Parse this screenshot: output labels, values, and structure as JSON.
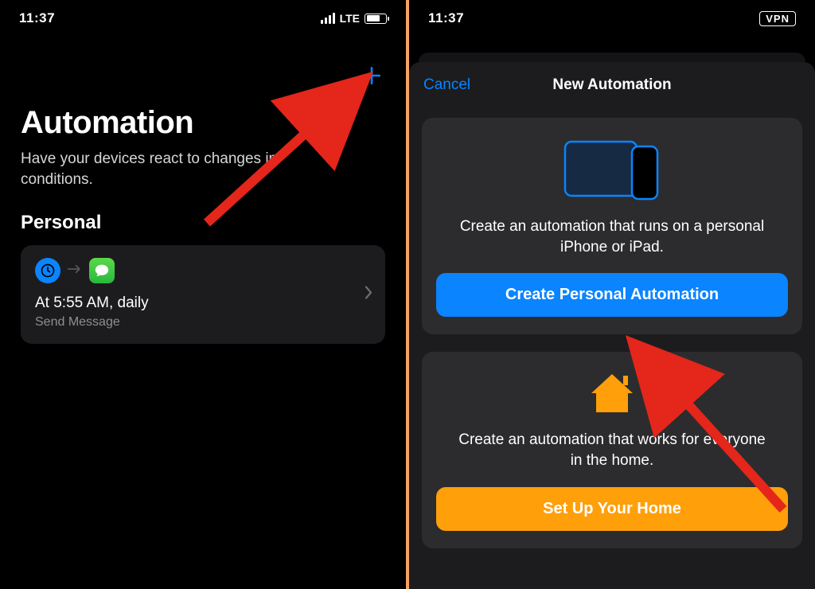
{
  "left": {
    "status": {
      "time": "11:37",
      "network_label": "LTE"
    },
    "title": "Automation",
    "subtitle": "Have your devices react to changes in conditions.",
    "section_heading": "Personal",
    "automation": {
      "title": "At 5:55 AM, daily",
      "subtitle": "Send Message"
    }
  },
  "right": {
    "status": {
      "time": "11:37",
      "vpn_label": "VPN"
    },
    "sheet": {
      "cancel_label": "Cancel",
      "title": "New Automation",
      "personal": {
        "description": "Create an automation that runs on a personal iPhone or iPad.",
        "button_label": "Create Personal Automation"
      },
      "home": {
        "description": "Create an automation that works for everyone in the home.",
        "button_label": "Set Up Your Home"
      }
    }
  }
}
